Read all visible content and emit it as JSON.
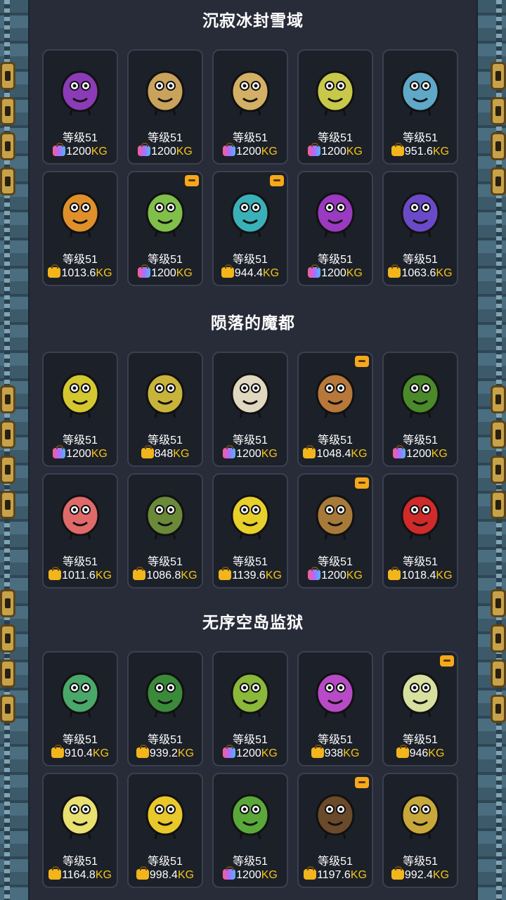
{
  "colors": {
    "background": "#272c38",
    "card": "#1c2029",
    "weight_unit": "#f5c518",
    "text": "#ffffff"
  },
  "sections": [
    {
      "title": "沉寂冰封雪域",
      "cards": [
        {
          "level": "等级51",
          "weight": "1200",
          "unit": "KG",
          "bag": "rainbow",
          "badge": false,
          "creature": "eggplant-creature",
          "color": "#8b3bb8"
        },
        {
          "level": "等级51",
          "weight": "1200",
          "unit": "KG",
          "bag": "rainbow",
          "badge": false,
          "creature": "mushroom-head-creature",
          "color": "#c9a35c"
        },
        {
          "level": "等级51",
          "weight": "1200",
          "unit": "KG",
          "bag": "rainbow",
          "badge": false,
          "creature": "rope-creature",
          "color": "#d4b066"
        },
        {
          "level": "等级51",
          "weight": "1200",
          "unit": "KG",
          "bag": "rainbow",
          "badge": false,
          "creature": "leafy-bird-creature",
          "color": "#c8c84a"
        },
        {
          "level": "等级51",
          "weight": "951.6",
          "unit": "KG",
          "bag": "gold",
          "badge": false,
          "creature": "blue-serpent-creature",
          "color": "#5fa8c8"
        },
        {
          "level": "等级51",
          "weight": "1013.6",
          "unit": "KG",
          "bag": "gold",
          "badge": false,
          "creature": "pear-creature",
          "color": "#e0902a"
        },
        {
          "level": "等级51",
          "weight": "1200",
          "unit": "KG",
          "bag": "rainbow",
          "badge": true,
          "creature": "leek-creature",
          "color": "#7fbf4a"
        },
        {
          "level": "等级51",
          "weight": "944.4",
          "unit": "KG",
          "bag": "gold",
          "badge": true,
          "creature": "bubble-jellyfish-creature",
          "color": "#3ab0b8"
        },
        {
          "level": "等级51",
          "weight": "1200",
          "unit": "KG",
          "bag": "rainbow",
          "badge": false,
          "creature": "purple-jellyfish-creature",
          "color": "#9a3ac0"
        },
        {
          "level": "等级51",
          "weight": "1063.6",
          "unit": "KG",
          "bag": "gold",
          "badge": false,
          "creature": "grape-head-creature",
          "color": "#6a4ac8"
        }
      ]
    },
    {
      "title": "陨落的魔都",
      "cards": [
        {
          "level": "等级51",
          "weight": "1200",
          "unit": "KG",
          "bag": "rainbow",
          "badge": false,
          "creature": "horned-frog-creature",
          "color": "#d4c830"
        },
        {
          "level": "等级51",
          "weight": "848",
          "unit": "KG",
          "bag": "gold",
          "badge": false,
          "creature": "hedgehog-creature",
          "color": "#c8b43a"
        },
        {
          "level": "等级51",
          "weight": "1200",
          "unit": "KG",
          "bag": "rainbow",
          "badge": false,
          "creature": "alpaca-creature",
          "color": "#e0d8c0"
        },
        {
          "level": "等级51",
          "weight": "1048.4",
          "unit": "KG",
          "bag": "gold",
          "badge": true,
          "creature": "clam-creature",
          "color": "#b8783a"
        },
        {
          "level": "等级51",
          "weight": "1200",
          "unit": "KG",
          "bag": "rainbow",
          "badge": false,
          "creature": "green-dino-creature",
          "color": "#4a8a2a"
        },
        {
          "level": "等级51",
          "weight": "1011.6",
          "unit": "KG",
          "bag": "gold",
          "badge": false,
          "creature": "peach-creature",
          "color": "#e06a6a"
        },
        {
          "level": "等级51",
          "weight": "1086.8",
          "unit": "KG",
          "bag": "gold",
          "badge": false,
          "creature": "hermit-crab-creature",
          "color": "#6a8a3a"
        },
        {
          "level": "等级51",
          "weight": "1139.6",
          "unit": "KG",
          "bag": "gold",
          "badge": false,
          "creature": "yellow-pear-creature",
          "color": "#e8d02a"
        },
        {
          "level": "等级51",
          "weight": "1200",
          "unit": "KG",
          "bag": "rainbow",
          "badge": true,
          "creature": "cowboy-creature",
          "color": "#a87a3a"
        },
        {
          "level": "等级51",
          "weight": "1018.4",
          "unit": "KG",
          "bag": "gold",
          "badge": false,
          "creature": "lips-creature",
          "color": "#d02a2a"
        }
      ]
    },
    {
      "title": "无序空岛监狱",
      "cards": [
        {
          "level": "等级51",
          "weight": "910.4",
          "unit": "KG",
          "bag": "gold",
          "badge": false,
          "creature": "turtle-creature",
          "color": "#4aa86a"
        },
        {
          "level": "等级51",
          "weight": "939.2",
          "unit": "KG",
          "bag": "gold",
          "badge": false,
          "creature": "watermelon-creature",
          "color": "#3a8a3a"
        },
        {
          "level": "等级51",
          "weight": "1200",
          "unit": "KG",
          "bag": "rainbow",
          "badge": false,
          "creature": "sprout-creature",
          "color": "#8ab83a"
        },
        {
          "level": "等级51",
          "weight": "938",
          "unit": "KG",
          "bag": "gold",
          "badge": false,
          "creature": "grape-spider-creature",
          "color": "#b84ac8"
        },
        {
          "level": "等级51",
          "weight": "946",
          "unit": "KG",
          "bag": "gold",
          "badge": true,
          "creature": "radish-creature",
          "color": "#d8e0a0"
        },
        {
          "level": "等级51",
          "weight": "1164.8",
          "unit": "KG",
          "bag": "gold",
          "badge": false,
          "creature": "cauliflower-creature",
          "color": "#e8e070"
        },
        {
          "level": "等级51",
          "weight": "998.4",
          "unit": "KG",
          "bag": "gold",
          "badge": false,
          "creature": "cheese-creature",
          "color": "#e8c82a"
        },
        {
          "level": "等级51",
          "weight": "1200",
          "unit": "KG",
          "bag": "rainbow",
          "badge": false,
          "creature": "snake-hair-creature",
          "color": "#5aa83a"
        },
        {
          "level": "等级51",
          "weight": "1197.6",
          "unit": "KG",
          "bag": "gold",
          "badge": true,
          "creature": "hairy-creature",
          "color": "#6a4a2a"
        },
        {
          "level": "等级51",
          "weight": "992.4",
          "unit": "KG",
          "bag": "gold",
          "badge": false,
          "creature": "onion-creature",
          "color": "#c8a83a"
        }
      ]
    }
  ]
}
